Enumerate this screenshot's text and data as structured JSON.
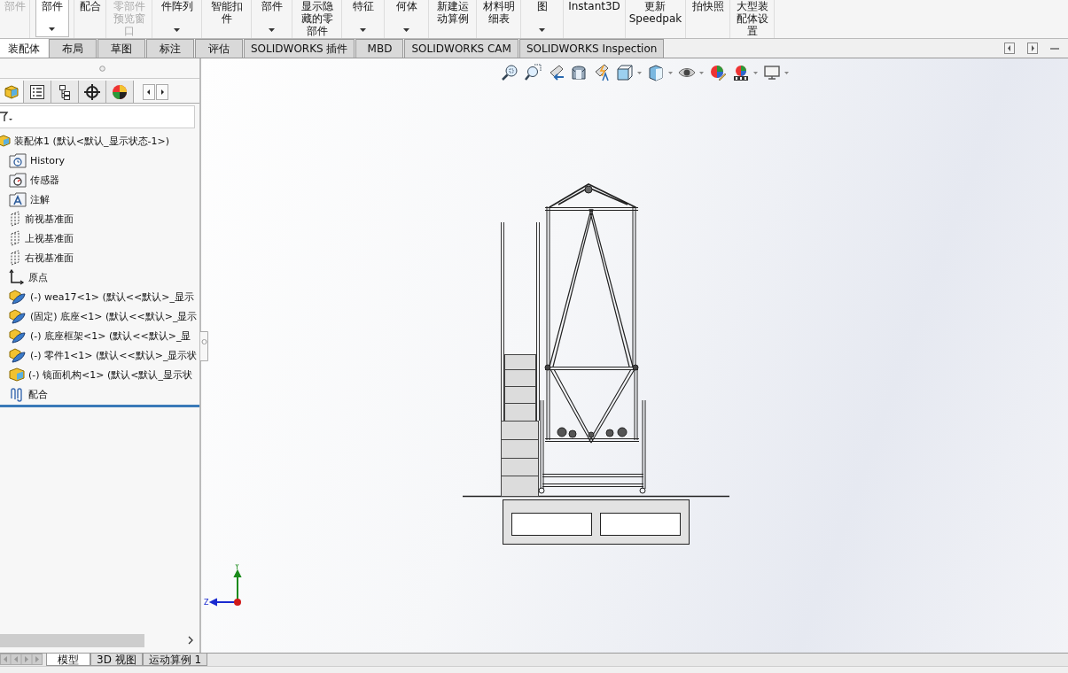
{
  "ribbon": {
    "buttons": [
      {
        "lines": [
          "部件"
        ],
        "kind": "plain",
        "disabled": true
      },
      {
        "lines": [
          "部件"
        ],
        "kind": "split",
        "disabled": false
      },
      {
        "lines": [
          "配合"
        ],
        "kind": "plain",
        "disabled": false
      },
      {
        "lines": [
          "零部件",
          "预览窗",
          "口"
        ],
        "kind": "plain",
        "disabled": true
      },
      {
        "lines": [
          "件阵列"
        ],
        "kind": "dropdown",
        "disabled": false
      },
      {
        "lines": [
          "智能扣",
          "件"
        ],
        "kind": "plain",
        "disabled": false
      },
      {
        "lines": [
          "部件"
        ],
        "kind": "dropdown",
        "disabled": false
      },
      {
        "lines": [
          "显示隐",
          "藏的零",
          "部件"
        ],
        "kind": "plain",
        "disabled": false
      },
      {
        "lines": [
          "特征"
        ],
        "kind": "dropdown",
        "disabled": false
      },
      {
        "lines": [
          "何体"
        ],
        "kind": "dropdown",
        "disabled": false
      },
      {
        "lines": [
          "新建运",
          "动算例"
        ],
        "kind": "plain",
        "disabled": false
      },
      {
        "lines": [
          "材料明",
          "细表"
        ],
        "kind": "plain",
        "disabled": false
      },
      {
        "lines": [
          "图"
        ],
        "kind": "dropdown",
        "disabled": false
      },
      {
        "lines": [
          "Instant3D"
        ],
        "kind": "plain",
        "disabled": false
      },
      {
        "lines": [
          "更新",
          "Speedpak"
        ],
        "kind": "plain",
        "disabled": false
      },
      {
        "lines": [
          "拍快照"
        ],
        "kind": "plain",
        "disabled": false
      },
      {
        "lines": [
          "大型装",
          "配体设",
          "置"
        ],
        "kind": "plain",
        "disabled": false
      }
    ]
  },
  "tabs": [
    {
      "label": "装配体",
      "selected": true
    },
    {
      "label": "布局",
      "selected": false
    },
    {
      "label": "草图",
      "selected": false
    },
    {
      "label": "标注",
      "selected": false
    },
    {
      "label": "评估",
      "selected": false
    },
    {
      "label": "SOLIDWORKS 插件",
      "selected": false
    },
    {
      "label": "MBD",
      "selected": false
    },
    {
      "label": "SOLIDWORKS CAM",
      "selected": false
    },
    {
      "label": "SOLIDWORKS Inspection",
      "selected": false
    }
  ],
  "tree": {
    "label": "装配体1  (默认<默认_显示状态-1>)",
    "kind": "assembly",
    "children": [
      {
        "label": "History",
        "kind": "history"
      },
      {
        "label": "传感器",
        "kind": "sensor"
      },
      {
        "label": "注解",
        "kind": "annotation"
      },
      {
        "label": "前视基准面",
        "kind": "plane"
      },
      {
        "label": "上视基准面",
        "kind": "plane"
      },
      {
        "label": "右视基准面",
        "kind": "plane"
      },
      {
        "label": "原点",
        "kind": "origin"
      },
      {
        "label": "(-) wea17<1> (默认<<默认>_显示",
        "kind": "part"
      },
      {
        "label": "(固定) 底座<1> (默认<<默认>_显示",
        "kind": "part"
      },
      {
        "label": "(-) 底座框架<1> (默认<<默认>_显",
        "kind": "part"
      },
      {
        "label": "(-) 零件1<1> (默认<<默认>_显示状",
        "kind": "part"
      },
      {
        "label": "(-) 镜面机构<1> (默认<默认_显示状",
        "kind": "assembly"
      },
      {
        "label": "配合",
        "kind": "mates"
      }
    ]
  },
  "view_tabs": [
    {
      "label": "模型",
      "selected": true
    },
    {
      "label": "3D 视图",
      "selected": false
    },
    {
      "label": "运动算例 1",
      "selected": false
    }
  ],
  "triad": {
    "y_label": "Y",
    "z_label": "Z"
  }
}
